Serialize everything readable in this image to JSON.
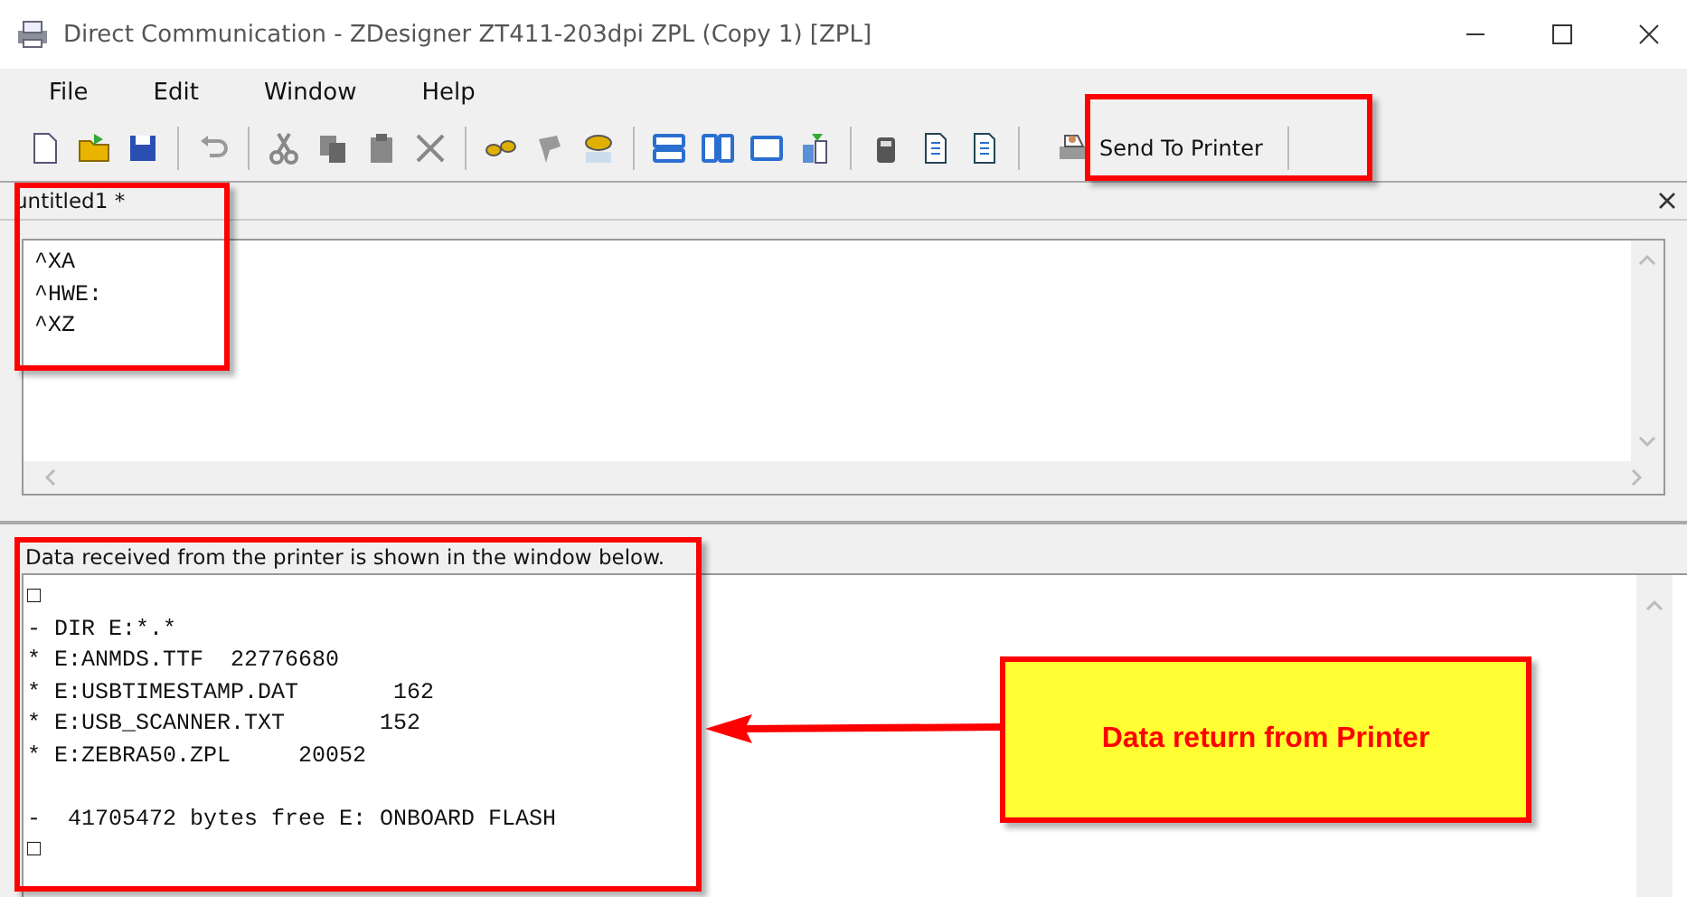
{
  "window": {
    "title": "Direct Communication - ZDesigner ZT411-203dpi ZPL (Copy 1) [ZPL]"
  },
  "menu": [
    "File",
    "Edit",
    "Window",
    "Help"
  ],
  "toolbar": {
    "send_button": "Send To Printer"
  },
  "document_tab": {
    "title": "untitled1 *"
  },
  "editor": {
    "lines": [
      "^XA",
      "^HWE:",
      "^XZ"
    ]
  },
  "output": {
    "caption": "Data received from the printer is shown in the window below.",
    "blocks": [
      {
        "lines": [
          "□",
          "- DIR E:*.*",
          "* E:ANMDS.TTF  22776680",
          "* E:USBTIMESTAMP.DAT       162",
          "* E:USB_SCANNER.TXT       152",
          "* E:ZEBRA50.ZPL     20052"
        ]
      },
      {
        "lines": [
          "-  41705472 bytes free E: ONBOARD FLASH",
          "□"
        ]
      }
    ]
  },
  "annotation": {
    "callout": "Data return from Printer"
  }
}
